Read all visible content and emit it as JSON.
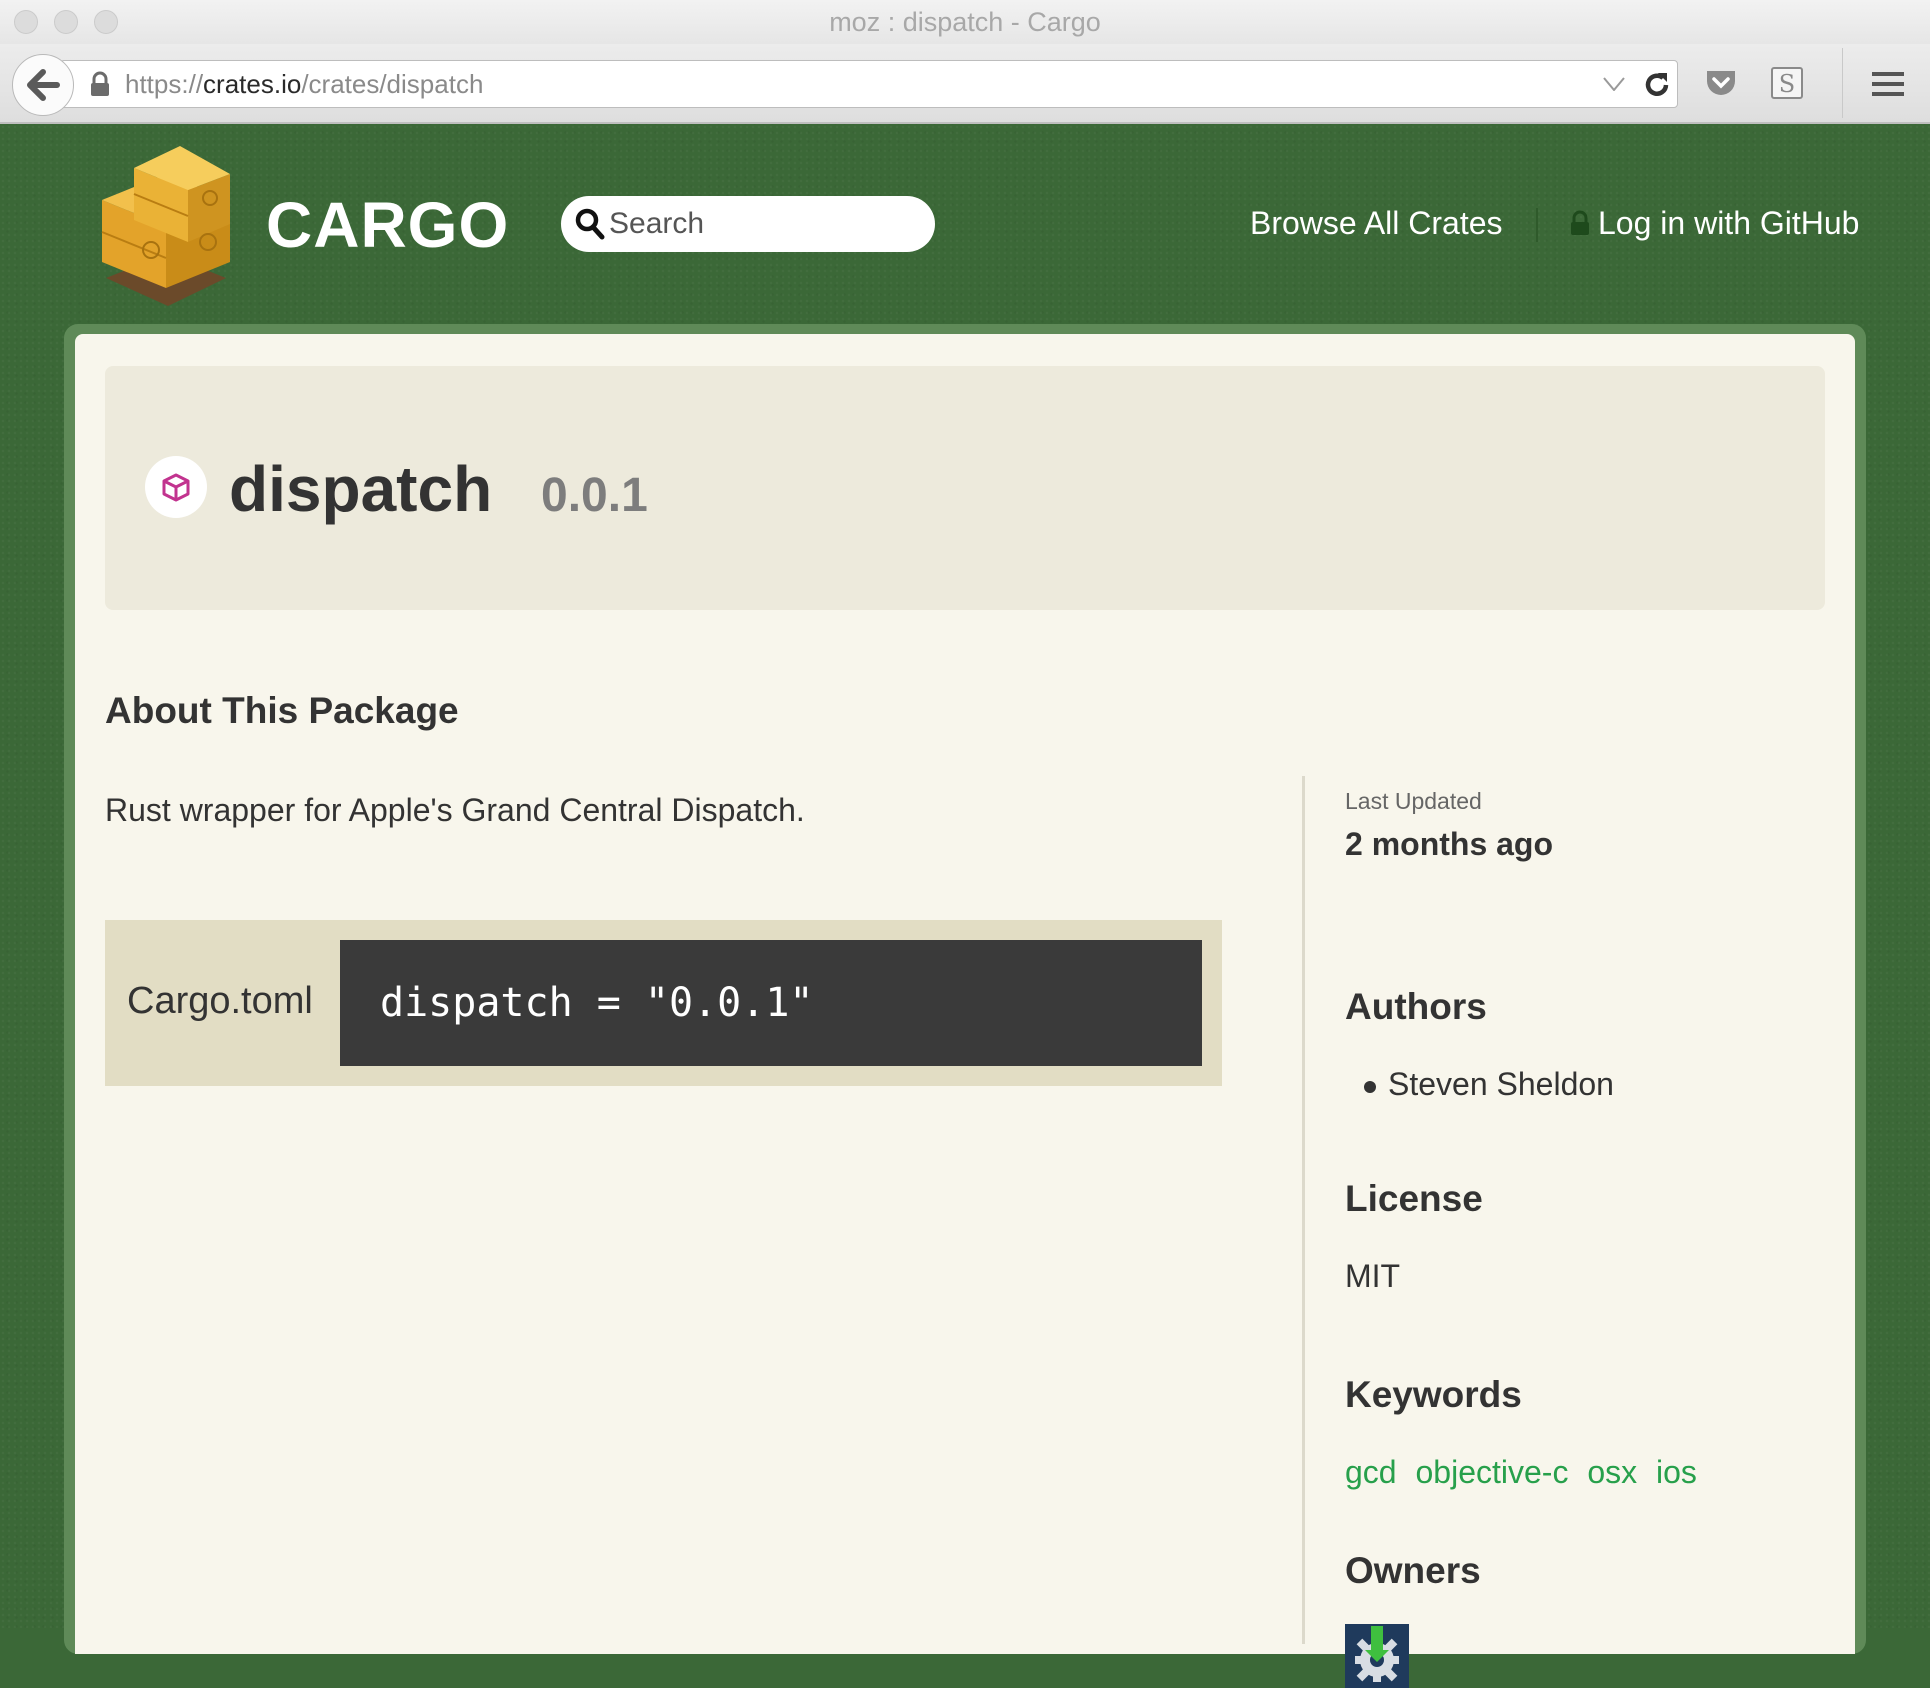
{
  "browser": {
    "window_title": "moz : dispatch - Cargo",
    "url_scheme": "https://",
    "url_host": "crates.io",
    "url_path": "/crates/dispatch"
  },
  "site": {
    "brand": "CARGO",
    "search_placeholder": "Search",
    "nav": {
      "browse": "Browse All Crates",
      "login": "Log in with GitHub"
    }
  },
  "crate": {
    "name": "dispatch",
    "version": "0.0.1",
    "about_title": "About This Package",
    "description": "Rust wrapper for Apple's Grand Central Dispatch.",
    "install_label": "Cargo.toml",
    "install_snippet": "dispatch = \"0.0.1\""
  },
  "sidebar": {
    "last_updated_label": "Last Updated",
    "last_updated_value": "2 months ago",
    "authors_title": "Authors",
    "authors": [
      "Steven Sheldon"
    ],
    "license_title": "License",
    "license": "MIT",
    "keywords_title": "Keywords",
    "keywords": [
      "gcd",
      "objective-c",
      "osx",
      "ios"
    ],
    "owners_title": "Owners"
  },
  "colors": {
    "page_background": "#3b6837",
    "card_background": "#f8f6ec",
    "keyword_link": "#27a04b",
    "code_background": "#3a3a3a"
  }
}
